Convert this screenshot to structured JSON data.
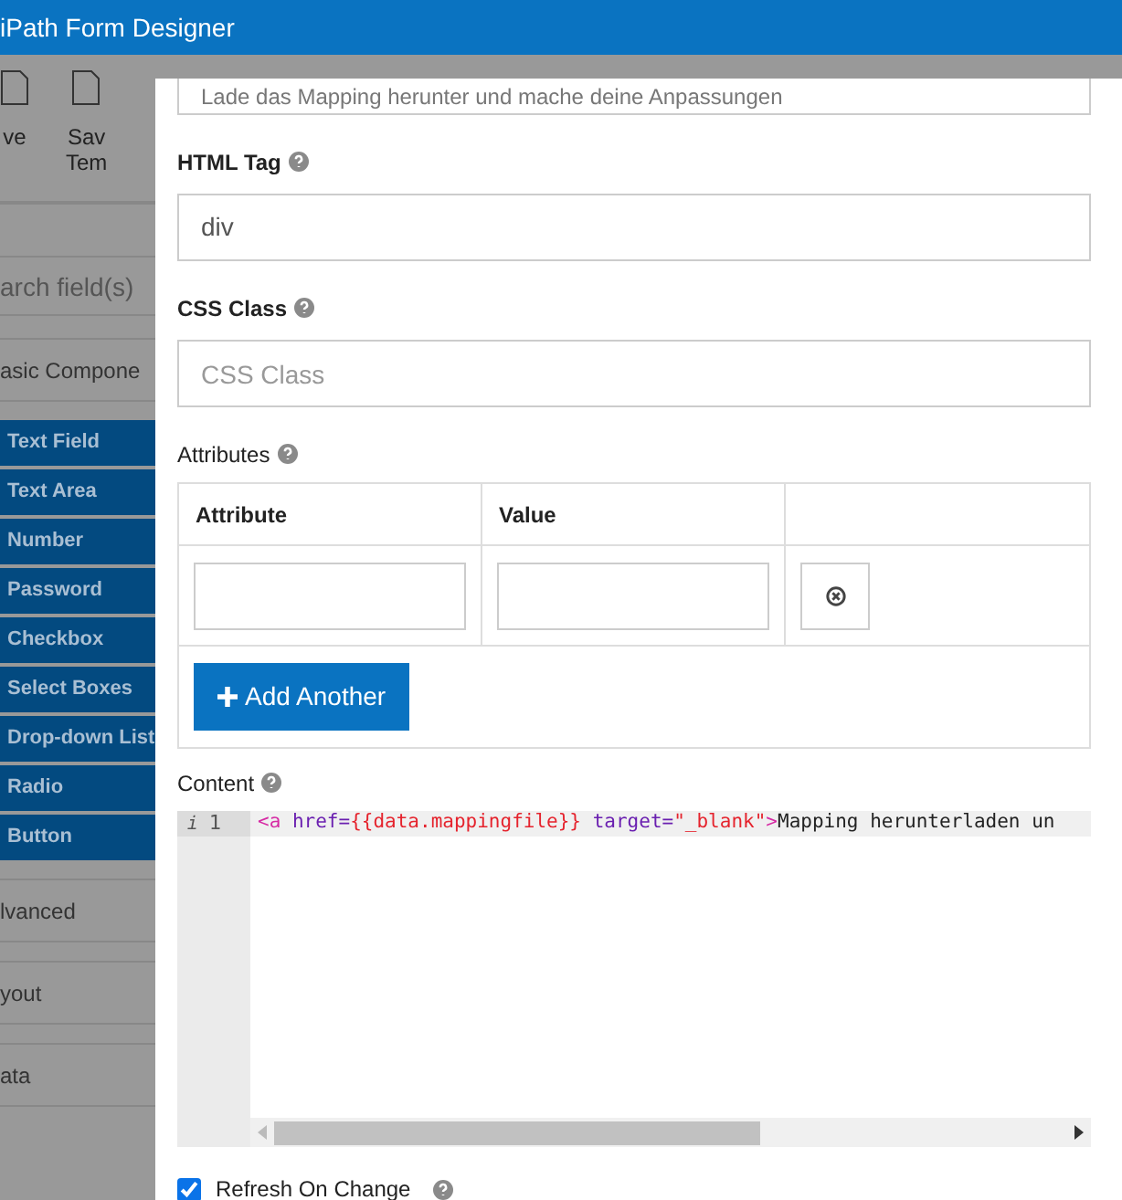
{
  "window": {
    "title": "iPath Form Designer"
  },
  "toolbar": {
    "buttons": [
      {
        "label": "ve"
      },
      {
        "label": "Sav\nTem"
      }
    ]
  },
  "sidebar": {
    "search": {
      "placeholder": "arch field(s)"
    },
    "groups": [
      {
        "label": "asic Compone",
        "items": [
          "Text Field",
          "Text Area",
          "Number",
          "Password",
          "Checkbox",
          "Select Boxes",
          "Drop-down List",
          "Radio",
          "Button"
        ]
      },
      {
        "label": "lvanced"
      },
      {
        "label": "yout"
      },
      {
        "label": "ata"
      }
    ]
  },
  "dialog": {
    "top_field": {
      "value": "Lade das Mapping herunter und mache deine Anpassungen"
    },
    "html_tag": {
      "label": "HTML Tag",
      "value": "div"
    },
    "css_class": {
      "label": "CSS Class",
      "placeholder": "CSS Class"
    },
    "attributes": {
      "label": "Attributes",
      "columns": [
        "Attribute",
        "Value"
      ],
      "add_button": "Add Another"
    },
    "content": {
      "label": "Content",
      "line_marker": "i",
      "line_number": "1",
      "code": [
        {
          "kind": "tag",
          "text": "<a "
        },
        {
          "kind": "attr",
          "text": "href="
        },
        {
          "kind": "string",
          "text": "{{data.mappingfile}}"
        },
        {
          "kind": "attr",
          "text": " target="
        },
        {
          "kind": "string",
          "text": "\"_blank\""
        },
        {
          "kind": "tag",
          "text": ">"
        },
        {
          "kind": "text",
          "text": "Mapping herunterladen un"
        }
      ]
    },
    "refresh_on_change": {
      "label": "Refresh On Change",
      "checked": true
    }
  }
}
